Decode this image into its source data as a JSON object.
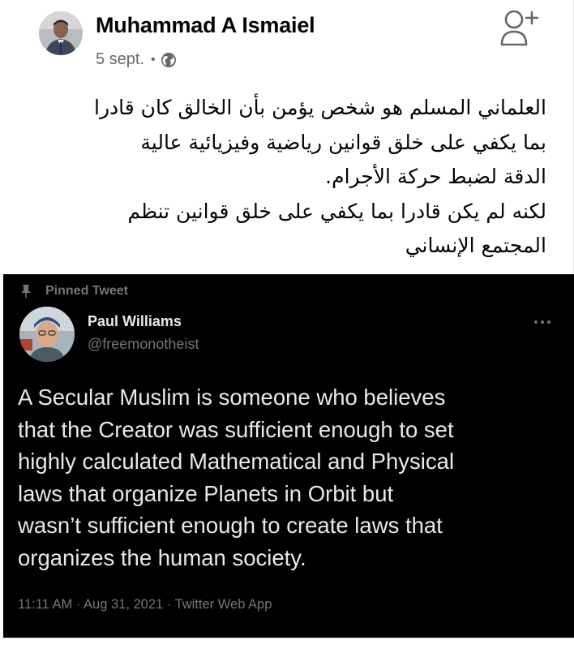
{
  "fb_post": {
    "author": "Muhammad A Ismaiel",
    "date": "5 sept.",
    "separator": "•",
    "privacy_icon": "globe-icon",
    "action_icon": "add-friend-icon",
    "text_lines": [
      "العلماني المسلم هو شخص يؤمن بأن الخالق كان قادرا",
      "بما يكفي على خلق قوانين رياضية وفيزيائية عالية",
      "الدقة لضبط حركة الأجرام.",
      "لكنه لم يكن قادرا بما يكفي على خلق قوانين تنظم",
      "المجتمع الإنساني"
    ]
  },
  "tweet": {
    "pinned_label": "Pinned Tweet",
    "pin_icon": "pin-icon",
    "name": "Paul Williams",
    "handle": "@freemonotheist",
    "more_icon": "more-icon",
    "text_lines": [
      "A Secular Muslim is someone who believes",
      "that the Creator was sufficient enough to set",
      "highly calculated Mathematical and Physical",
      "laws that organize Planets in Orbit but",
      "wasn’t sufficient enough to create laws that",
      "organizes the human society."
    ],
    "time": "11:11 AM",
    "date": "Aug 31, 2021",
    "source": "Twitter Web App",
    "footer_separator": "·"
  },
  "colors": {
    "fb_text": "#050505",
    "fb_meta": "#65676b",
    "tweet_bg": "#000000",
    "tweet_text": "#e7e9ea",
    "tweet_muted": "#71767b"
  }
}
